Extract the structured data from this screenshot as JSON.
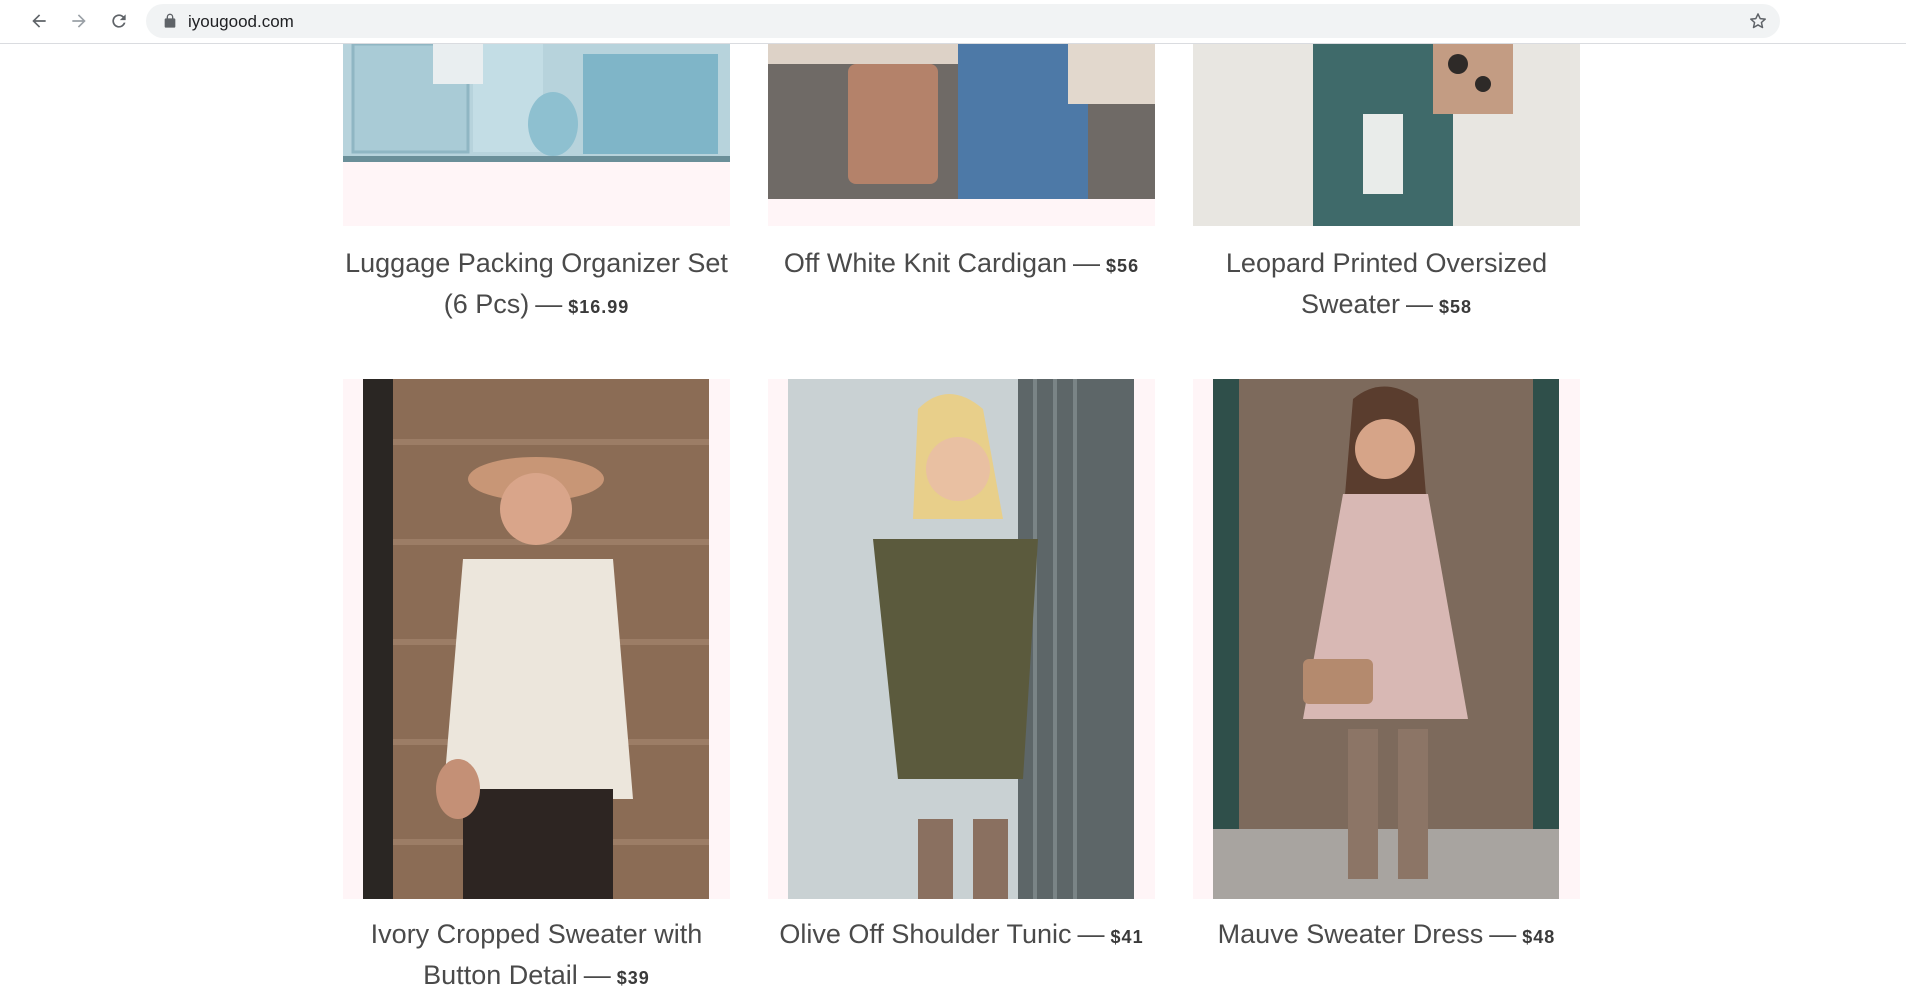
{
  "browser": {
    "url": "iyougood.com"
  },
  "products": [
    {
      "title": "Luggage Packing Organizer Set (6 Pcs)",
      "price": "$16.99",
      "separator": "—"
    },
    {
      "title": "Off White Knit Cardigan",
      "price": "$56",
      "separator": "—"
    },
    {
      "title": "Leopard Printed Oversized Sweater",
      "price": "$58",
      "separator": "—"
    },
    {
      "title": "Ivory Cropped Sweater with Button Detail",
      "price": "$39",
      "separator": "—"
    },
    {
      "title": "Olive Off Shoulder Tunic",
      "price": "$41",
      "separator": "—"
    },
    {
      "title": "Mauve Sweater Dress",
      "price": "$48",
      "separator": "—"
    }
  ],
  "colors": {
    "image_frame_bg": "#fff5f7",
    "text": "#4a4a4a"
  }
}
